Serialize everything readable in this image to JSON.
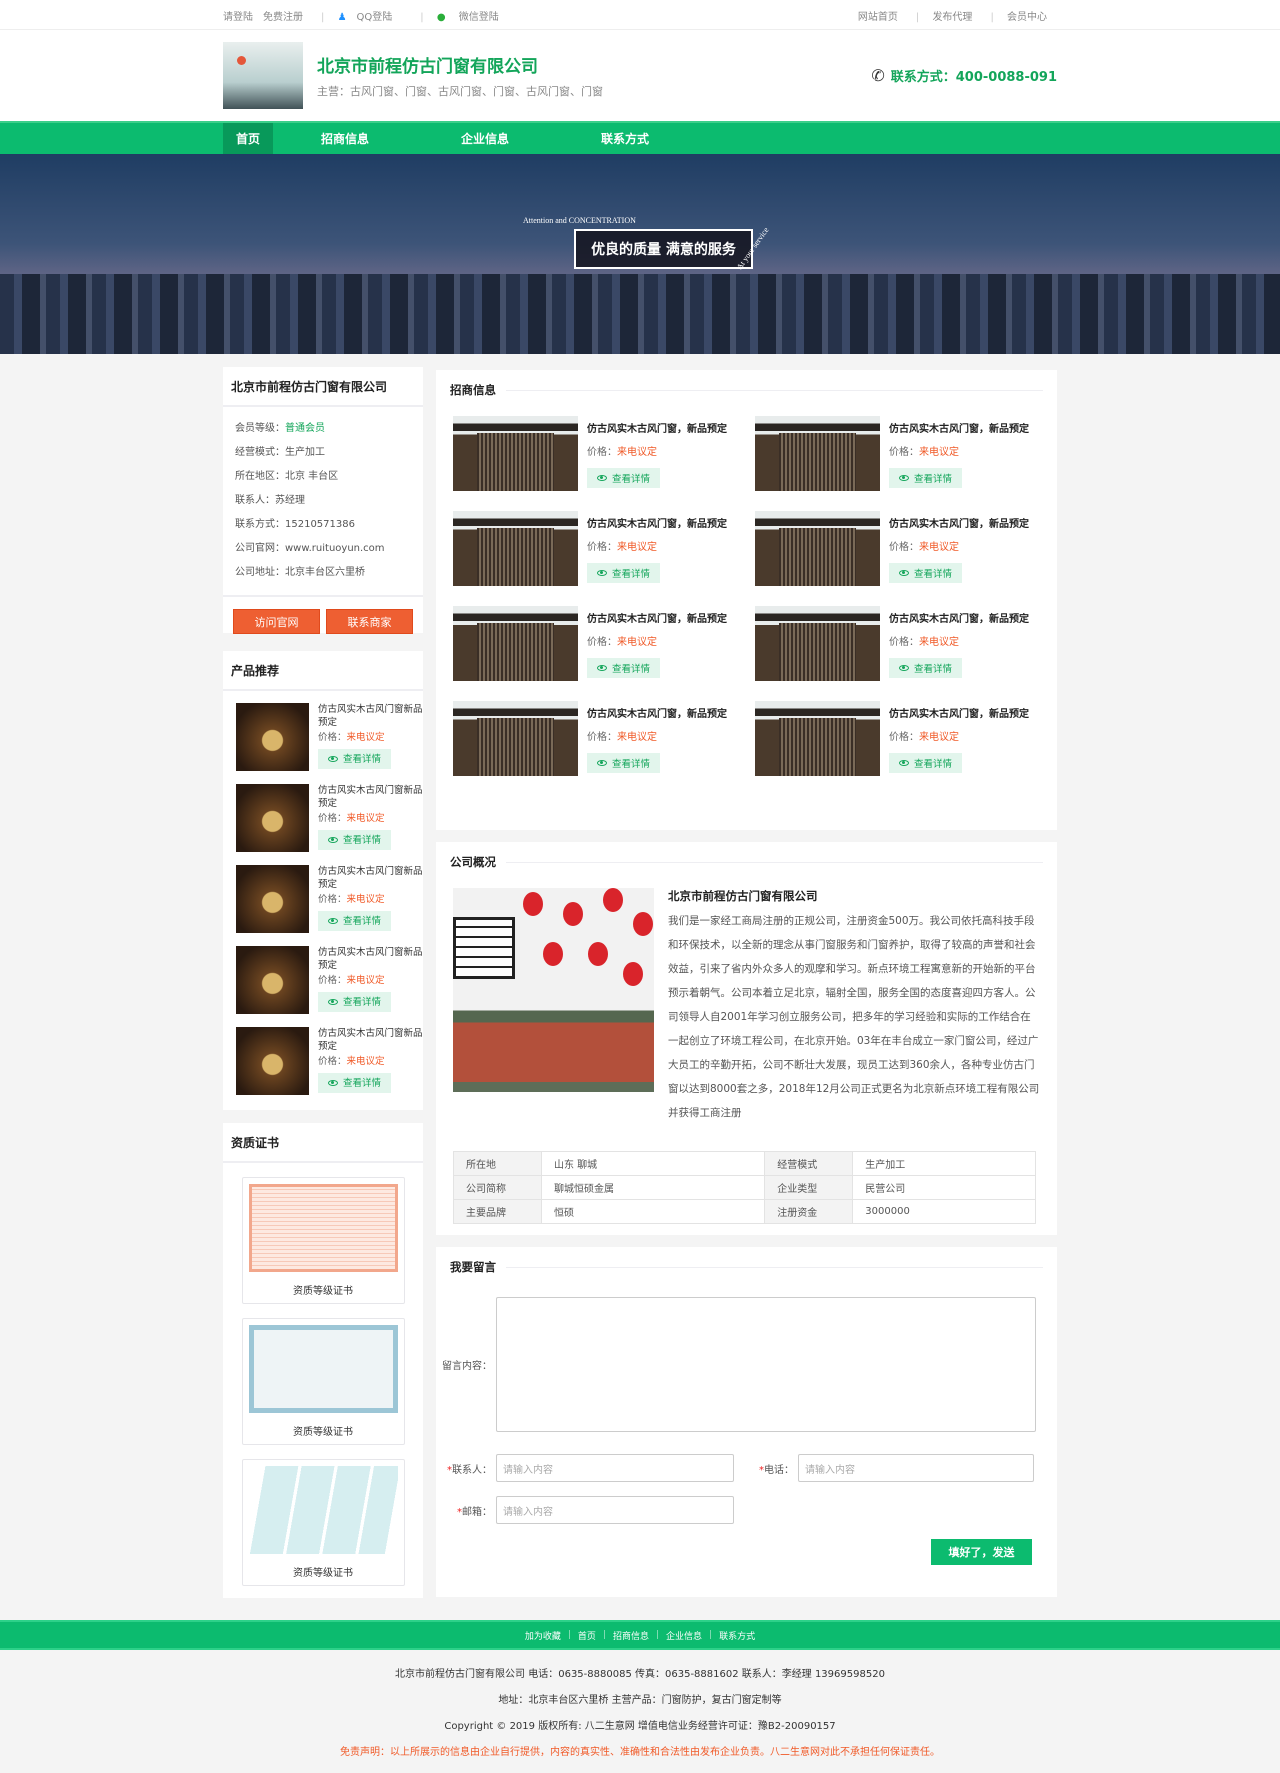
{
  "topbar": {
    "login": "请登陆",
    "register": "免费注册",
    "qq": "QQ登陆",
    "wechat": "微信登陆",
    "links": [
      "网站首页",
      "发布代理",
      "会员中心"
    ]
  },
  "header": {
    "company": "北京市前程仿古门窗有限公司",
    "main_business": "主营：古风门窗、门窗、古风门窗、门窗、古风门窗、门窗",
    "contact": "联系方式：400-0088-091"
  },
  "nav": [
    "首页",
    "招商信息",
    "企业信息",
    "联系方式"
  ],
  "banner": {
    "small": "Attention and CONCENTRATION",
    "headline": "优良的质量  满意的服务",
    "side": "At your service"
  },
  "sidebar": {
    "company": "北京市前程仿古门窗有限公司",
    "info": [
      {
        "k": "会员等级：",
        "v": "普通会员"
      },
      {
        "k": "经营模式：",
        "v": "生产加工"
      },
      {
        "k": "所在地区：",
        "v": "北京    丰台区"
      },
      {
        "k": "联系人：",
        "v": "苏经理"
      },
      {
        "k": "联系方式：",
        "v": "15210571386"
      },
      {
        "k": "公司官网：",
        "v": "www.ruituoyun.com"
      },
      {
        "k": "公司地址：",
        "v": "北京丰台区六里桥"
      }
    ],
    "visit": "访问官网",
    "contact": "联系商家",
    "products_title": "产品推荐",
    "products": [
      {
        "name": "仿古风实木古风门窗新品预定",
        "price_label": "价格：",
        "price": "来电议定",
        "btn": "查看详情"
      },
      {
        "name": "仿古风实木古风门窗新品预定",
        "price_label": "价格：",
        "price": "来电议定",
        "btn": "查看详情"
      },
      {
        "name": "仿古风实木古风门窗新品预定",
        "price_label": "价格：",
        "price": "来电议定",
        "btn": "查看详情"
      },
      {
        "name": "仿古风实木古风门窗新品预定",
        "price_label": "价格：",
        "price": "来电议定",
        "btn": "查看详情"
      },
      {
        "name": "仿古风实木古风门窗新品预定",
        "price_label": "价格：",
        "price": "来电议定",
        "btn": "查看详情"
      }
    ],
    "certs_title": "资质证书",
    "certs": [
      "资质等级证书",
      "资质等级证书",
      "资质等级证书"
    ]
  },
  "zhaoshang": {
    "title": "招商信息",
    "items": [
      {
        "name": "仿古风实木古风门窗，新品预定",
        "price_label": "价格：",
        "price": "来电议定",
        "btn": "查看详情"
      },
      {
        "name": "仿古风实木古风门窗，新品预定",
        "price_label": "价格：",
        "price": "来电议定",
        "btn": "查看详情"
      },
      {
        "name": "仿古风实木古风门窗，新品预定",
        "price_label": "价格：",
        "price": "来电议定",
        "btn": "查看详情"
      },
      {
        "name": "仿古风实木古风门窗，新品预定",
        "price_label": "价格：",
        "price": "来电议定",
        "btn": "查看详情"
      },
      {
        "name": "仿古风实木古风门窗，新品预定",
        "price_label": "价格：",
        "price": "来电议定",
        "btn": "查看详情"
      },
      {
        "name": "仿古风实木古风门窗，新品预定",
        "price_label": "价格：",
        "price": "来电议定",
        "btn": "查看详情"
      },
      {
        "name": "仿古风实木古风门窗，新品预定",
        "price_label": "价格：",
        "price": "来电议定",
        "btn": "查看详情"
      },
      {
        "name": "仿古风实木古风门窗，新品预定",
        "price_label": "价格：",
        "price": "来电议定",
        "btn": "查看详情"
      }
    ]
  },
  "overview": {
    "title": "公司概况",
    "company": "北京市前程仿古门窗有限公司",
    "text": "我们是一家经工商局注册的正规公司，注册资金500万。我公司依托高科技手段和环保技术，以全新的理念从事门窗服务和门窗养护，取得了较高的声誉和社会效益，引来了省内外众多人的观摩和学习。新点环境工程寓意新的开始新的平台预示着朝气。公司本着立足北京，辐射全国，服务全国的态度喜迎四方客人。公司领导人自2001年学习创立服务公司，把多年的学习经验和实际的工作结合在一起创立了环境工程公司，在北京开始。03年在丰台成立一家门窗公司，经过广大员工的辛勤开拓，公司不断壮大发展，现员工达到360余人，各种专业仿古门窗以达到8000套之多，2018年12月公司正式更名为北京新点环境工程有限公司并获得工商注册",
    "table": [
      [
        "所在地",
        "山东 聊城",
        "经营模式",
        "生产加工"
      ],
      [
        "公司简称",
        "聊城恒硕金属",
        "企业类型",
        "民营公司"
      ],
      [
        "主要品牌",
        "恒硕",
        "注册资金",
        "3000000"
      ]
    ]
  },
  "message": {
    "title": "我要留言",
    "content_label": "留言内容：",
    "contact_label": "联系人：",
    "phone_label": "电话：",
    "email_label": "邮箱：",
    "placeholder": "请输入内容",
    "required": "*",
    "submit": "填好了，发送"
  },
  "footer": {
    "links": [
      "加为收藏",
      "首页",
      "招商信息",
      "企业信息",
      "联系方式"
    ],
    "line1": "北京市前程仿古门窗有限公司 电话：0635-8880085 传真：0635-8881602 联系人：李经理 13969598520",
    "line2": "地址：北京丰台区六里桥   主营产品：门窗防护，复古门窗定制等",
    "line3": "Copyright © 2019 版权所有: 八二生意网 增值电信业务经营许可证：豫B2-20090157",
    "disclaimer": "免责声明：以上所展示的信息由企业自行提供，内容的真实性、准确性和合法性由发布企业负责。八二生意网对此不承担任何保证责任。"
  },
  "colors": {
    "green": "#0cbb6f",
    "orange": "#ee5f32",
    "price": "#f05a28"
  }
}
